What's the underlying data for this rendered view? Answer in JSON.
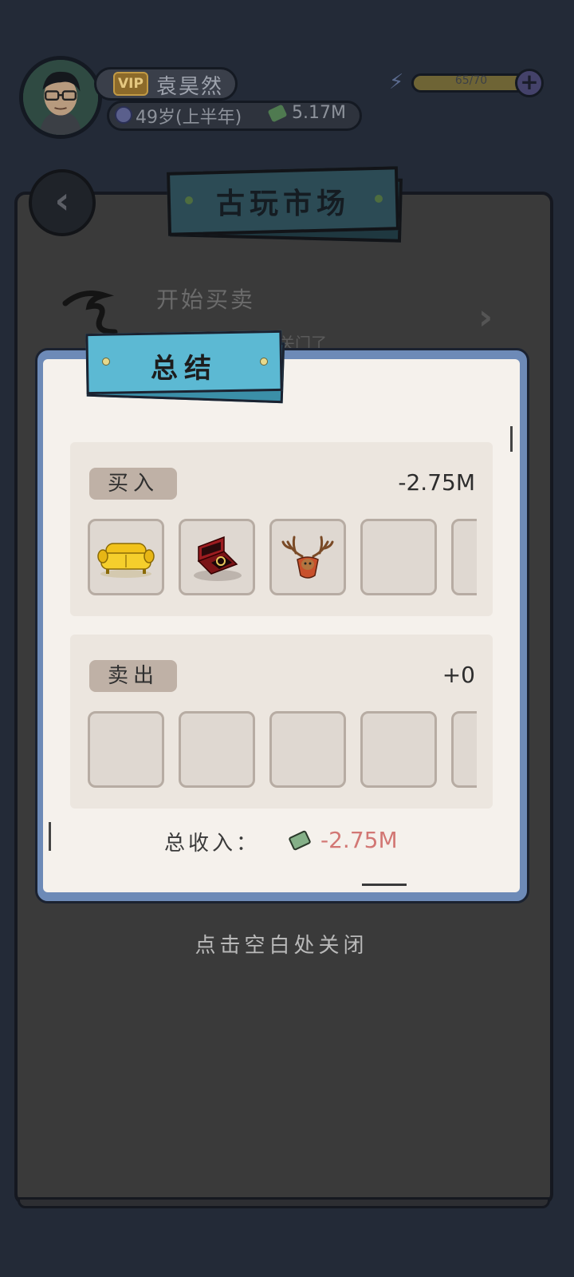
{
  "player": {
    "vip_label": "VIP",
    "name": "袁昊然",
    "age": "49岁(上半年)",
    "cash": "5.17M"
  },
  "energy": {
    "text": "65/70",
    "fraction": 0.93
  },
  "market": {
    "title": "古玩市场",
    "start_trade_title": "开始买卖",
    "start_trade_subtitle": "关门了"
  },
  "summary": {
    "title": "总结",
    "buy": {
      "label": "买入",
      "amount": "-2.75M",
      "items": [
        "yellow-sofa",
        "ring-box",
        "deer-antler-trophy",
        "",
        ""
      ]
    },
    "sell": {
      "label": "卖出",
      "amount": "+0",
      "items": [
        "",
        "",
        "",
        "",
        ""
      ]
    },
    "total_label": "总收入：",
    "total_value": "-2.75M"
  },
  "close_hint": "点击空白处关闭",
  "colors": {
    "background": "#232a37",
    "dialog_frame": "#6d8ab7",
    "dialog_sign": "#5cb9d3",
    "negative_value": "#d27774"
  }
}
